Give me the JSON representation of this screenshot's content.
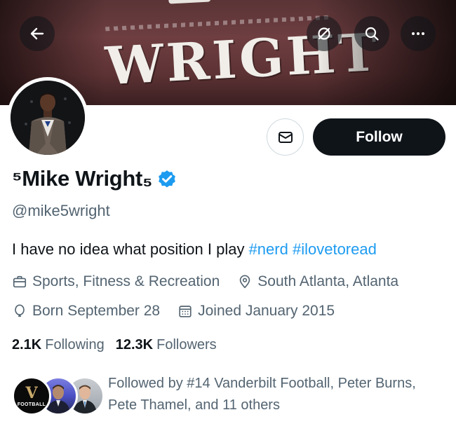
{
  "banner": {
    "jersey_text": "WRIGHT",
    "icons": {
      "back": "arrow-left-icon",
      "grok": "grok-icon",
      "search": "search-icon",
      "more": "more-horizontal-icon"
    }
  },
  "profile": {
    "display_name": "⁵Mike Wright₅",
    "verified": true,
    "handle": "@mike5wright",
    "bio_text": "I have no idea what position I play ",
    "bio_tags": [
      "#nerd",
      "#ilovetoread"
    ],
    "category": "Sports, Fitness & Recreation",
    "location": "South Atlanta, Atlanta",
    "born": "Born September 28",
    "joined": "Joined January 2015",
    "following_count": "2.1K",
    "following_label": "Following",
    "followers_count": "12.3K",
    "followers_label": "Followers"
  },
  "actions": {
    "follow_label": "Follow",
    "message_icon": "mail-icon"
  },
  "followed_by": {
    "text": "Followed by #14 Vanderbilt Football, Peter Burns, Pete Thamel, and 11 others",
    "avatar_1_mark": "V",
    "avatar_1_caption": "FOOTBALL"
  },
  "colors": {
    "accent": "#1d9bf0",
    "text_primary": "#0f1419",
    "text_secondary": "#536471",
    "follow_button_bg": "#0f1419",
    "banner_maroon": "#5e3335"
  }
}
